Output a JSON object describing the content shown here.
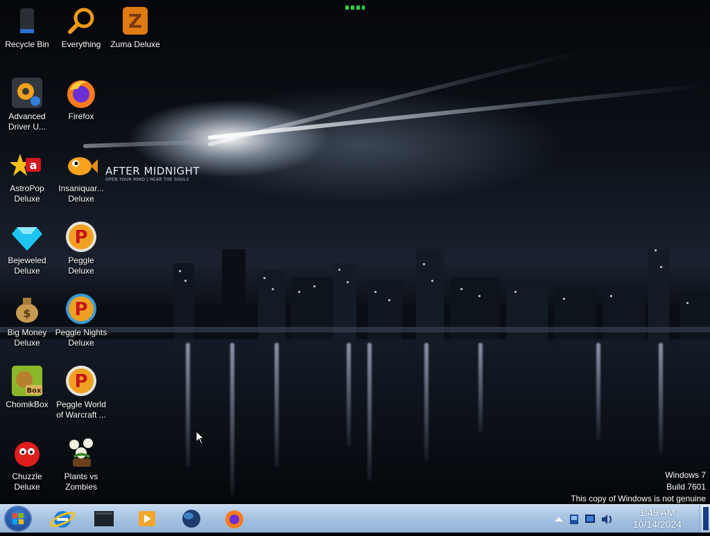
{
  "desktop": {
    "icons": [
      {
        "label": "Recycle Bin",
        "icon": "recycle-bin-icon"
      },
      {
        "label": "Everything",
        "icon": "everything-search-icon"
      },
      {
        "label": "Zuma Deluxe",
        "icon": "zuma-deluxe-icon"
      },
      {
        "label": "Advanced Driver U...",
        "icon": "advanced-driver-updater-icon"
      },
      {
        "label": "Firefox",
        "icon": "firefox-icon"
      },
      {
        "label": "AstroPop Deluxe",
        "icon": "astropop-icon"
      },
      {
        "label": "Insaniquar... Deluxe",
        "icon": "insaniquarium-icon"
      },
      {
        "label": "Bejeweled Deluxe",
        "icon": "bejeweled-icon"
      },
      {
        "label": "Peggle Deluxe",
        "icon": "peggle-icon"
      },
      {
        "label": "Big Money Deluxe",
        "icon": "big-money-icon"
      },
      {
        "label": "Peggle Nights Deluxe",
        "icon": "peggle-nights-icon"
      },
      {
        "label": "ChomikBox",
        "icon": "chomikbox-icon"
      },
      {
        "label": "Peggle World of Warcraft ...",
        "icon": "peggle-wow-icon"
      },
      {
        "label": "Chuzzle Deluxe",
        "icon": "chuzzle-icon"
      },
      {
        "label": "Plants vs Zombies",
        "icon": "plants-vs-zombies-icon"
      }
    ]
  },
  "wallpaper": {
    "title": "AFTER MIDNIGHT",
    "subtitle": "OPEN YOUR MIND | HEAR THE SOULS"
  },
  "watermark": {
    "line1": "Windows 7",
    "line2": "Build 7601",
    "line3": "This copy of Windows is not genuine"
  },
  "taskbar": {
    "pinned": [
      {
        "name": "internet-explorer-icon"
      },
      {
        "name": "file-explorer-icon"
      },
      {
        "name": "media-player-icon"
      },
      {
        "name": "globe-icon"
      },
      {
        "name": "firefox-taskbar-icon"
      }
    ],
    "tray": {
      "time": "1:49 AM",
      "date": "10/14/2024"
    }
  },
  "colors": {
    "taskbar": "#a9c4e2",
    "start_orb": "#1d4f9e",
    "label_text": "#ffffff"
  }
}
